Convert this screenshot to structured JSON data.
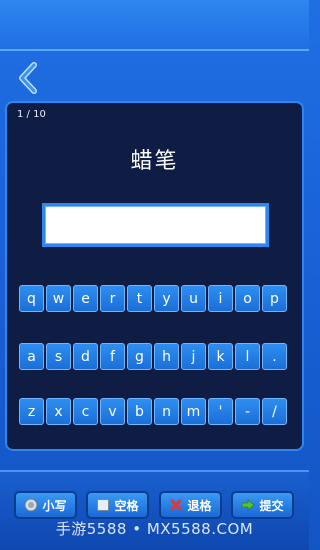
{
  "header": {
    "back_icon": "chevron-left-icon"
  },
  "quiz": {
    "progress": "1 / 10",
    "word": "蜡笔",
    "answer_value": ""
  },
  "keyboard": {
    "row1": [
      "q",
      "w",
      "e",
      "r",
      "t",
      "y",
      "u",
      "i",
      "o",
      "p"
    ],
    "row2": [
      "a",
      "s",
      "d",
      "f",
      "g",
      "h",
      "j",
      "k",
      "l",
      "."
    ],
    "row3": [
      "z",
      "x",
      "c",
      "v",
      "b",
      "n",
      "m",
      "'",
      "-",
      "/"
    ]
  },
  "actions": {
    "lowercase": {
      "label": "小写",
      "icon": "toggle-circle-icon"
    },
    "space": {
      "label": "空格",
      "icon": "square-icon"
    },
    "backspace": {
      "label": "退格",
      "icon": "red-x-icon"
    },
    "submit": {
      "label": "提交",
      "icon": "green-arrow-icon"
    }
  },
  "watermark": "手游5588 • MX5588.COM",
  "colors": {
    "background": "#1f6fe3",
    "panel": "#0f1d45",
    "key": "#2e8ef0",
    "key_border": "#6fb6ff"
  }
}
